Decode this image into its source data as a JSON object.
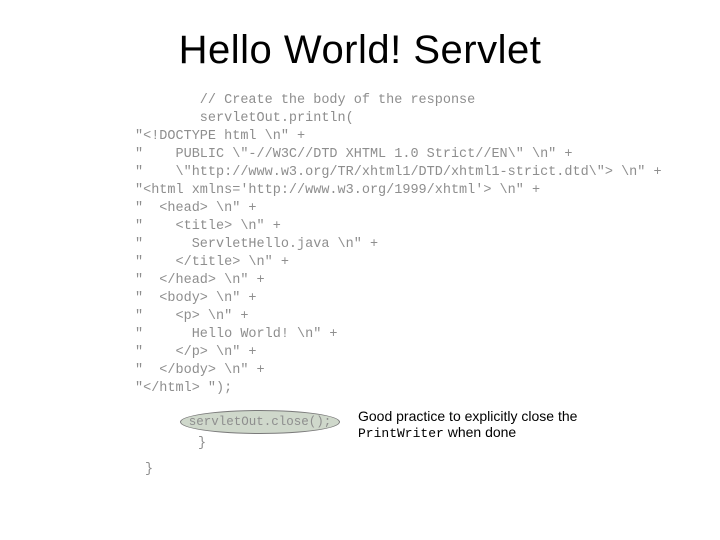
{
  "title": "Hello World! Servlet",
  "code": {
    "lines": [
      "        // Create the body of the response",
      "        servletOut.println(",
      "\"<!DOCTYPE html \\n\" +",
      "\"    PUBLIC \\\"-//W3C//DTD XHTML 1.0 Strict//EN\\\" \\n\" +",
      "\"    \\\"http://www.w3.org/TR/xhtml1/DTD/xhtml1-strict.dtd\\\"> \\n\" +",
      "\"<html xmlns='http://www.w3.org/1999/xhtml'> \\n\" +",
      "\"  <head> \\n\" +",
      "\"    <title> \\n\" +",
      "\"      ServletHello.java \\n\" +",
      "\"    </title> \\n\" +",
      "\"  </head> \\n\" +",
      "\"  <body> \\n\" +",
      "\"    <p> \\n\" +",
      "\"      Hello World! \\n\" +",
      "\"    </p> \\n\" +",
      "\"  </body> \\n\" +",
      "\"</html> \");"
    ],
    "close_call": "servletOut.close();",
    "brace_inner": "}",
    "brace_outer": "}"
  },
  "annotation": {
    "prefix": "Good practice to explicitly close the ",
    "mono": "PrintWriter",
    "suffix": " when done"
  }
}
